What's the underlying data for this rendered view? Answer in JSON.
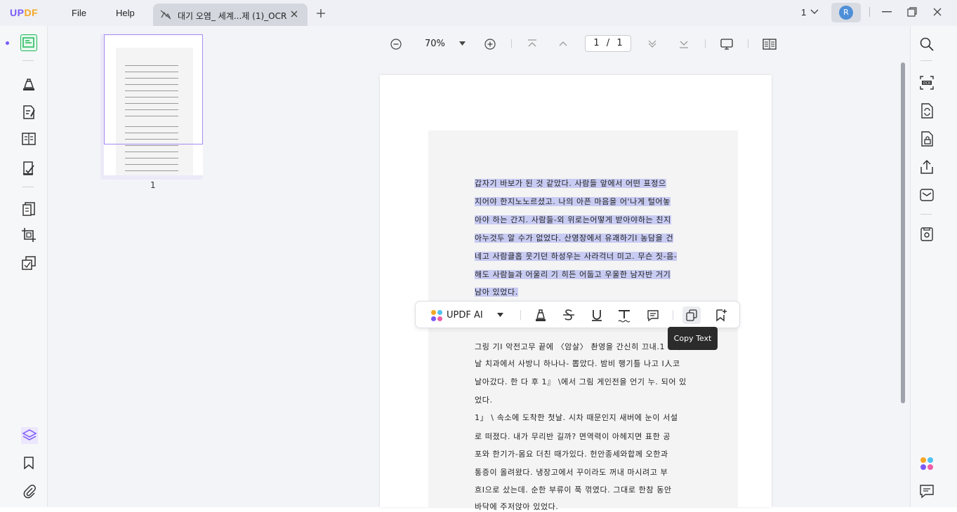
{
  "app": {
    "logo_up": "UP",
    "logo_df": "DF",
    "brand_color": "#7a5af8"
  },
  "menu": {
    "file": "File",
    "help": "Help"
  },
  "tab": {
    "title": "대기 오염_ 세계...제 (1)_OCR"
  },
  "window": {
    "page_count_label": "1",
    "avatar_letter": "R"
  },
  "toolbar": {
    "zoom": "70%",
    "page_current": "1",
    "page_sep": "/",
    "page_total": "1"
  },
  "thumbnail": {
    "page_number": "1"
  },
  "document": {
    "highlighted_lines": [
      "  갑자기 바보가 된 것 같았다. 사람들 앞에서 어떤 표정으",
      "지어야 한지노노르셨고. 나의 아픈 마음을 어'나게 털어놓",
      "아야 하는 간지. 사람들-외 위로는어떻게 받아야하는 친지",
      "아누것두 알 수가 없었다. 산영장에서 유괘하기I 농담을 건",
      "네고 사람클홉 웃기던 하성우는 사라걱너 미고. 무슨 짓-음-",
      "해도 사람늘과 어울리 기 히든 어둡고 우울한 남자반 거기",
      "남아 있었다."
    ],
    "lines": [
      "  그링 기I 악전고무 끝에 〈암살〉 촨영을 간신히 끄내.1 !  다",
      "날 치과에서 사방니 하나나- 뽑았다. 밤비 행기틀 나고 I人코",
      "날아갔다. 한 다 후 1』 \\에서 그림 게인전을 언기 누. 되어 있",
      "었다.",
      "  1」 \\ 속소에 도착한 첫날. 시차 때문인지 새버에 눈이 서설",
      "로 떠졌다. 내가 무리반 길까? 면역력이 아헤지면 표한 공",
      "포와 한기가-몸요 더친 때가있다. 헌안종세와합께 오한과",
      "통증이 올려왔다. 냉장고에서 꾸이라도 꺼내 마시려고 부",
      "흐I으로 샀는데. 순한 부류이 푹 꺾였다. 그대로 한참 동안",
      "바닥에 주저앉아 있었다."
    ]
  },
  "float_toolbar": {
    "ai_label": "UPDF AI",
    "tooltip": "Copy Text"
  },
  "icons": {
    "left": [
      "reader-icon",
      "comment-icon",
      "edit-pdf-icon",
      "organize-pages-icon",
      "fill-sign-icon",
      "convert-icon",
      "crop-icon",
      "page-tools-icon",
      "layers-icon",
      "bookmark-icon",
      "attachment-icon"
    ],
    "right": [
      "search-icon",
      "ocr-icon",
      "convert-pdf-icon",
      "protect-icon",
      "share-icon",
      "email-icon",
      "save-icon",
      "updf-ai-icon",
      "chat-icon"
    ]
  }
}
